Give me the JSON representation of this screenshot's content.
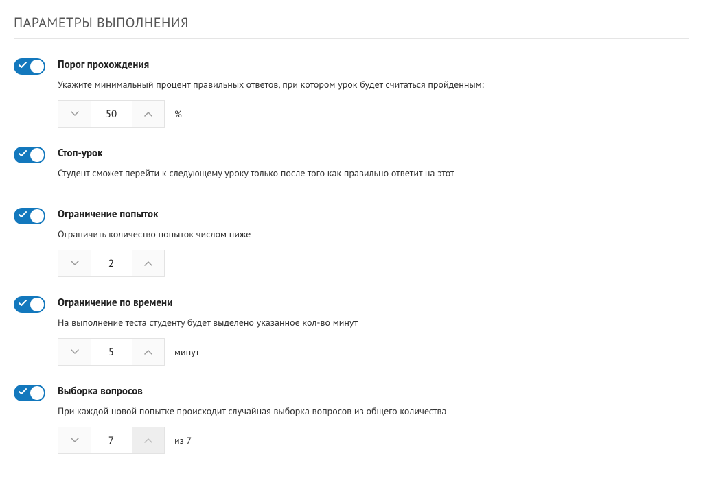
{
  "section": {
    "title": "ПАРАМЕТРЫ ВЫПОЛНЕНИЯ"
  },
  "options": {
    "pass_threshold": {
      "title": "Порог прохождения",
      "desc": "Укажите минимальный процент правильных ответов, при котором урок будет считаться пройденным:",
      "value": "50",
      "unit": "%"
    },
    "stop_lesson": {
      "title": "Стоп-урок",
      "desc": "Студент сможет перейти к следующему уроку только после того как правильно ответит на этот"
    },
    "attempt_limit": {
      "title": "Ограничение попыток",
      "desc": "Ограничить количество попыток числом ниже",
      "value": "2"
    },
    "time_limit": {
      "title": "Ограничение по времени",
      "desc": "На выполнение теста студенту будет выделено указанное кол-во минут",
      "value": "5",
      "unit": "минут"
    },
    "question_sample": {
      "title": "Выборка вопросов",
      "desc": "При каждой новой попытке происходит случайная выборка вопросов из общего количества",
      "value": "7",
      "unit": "из 7"
    }
  }
}
